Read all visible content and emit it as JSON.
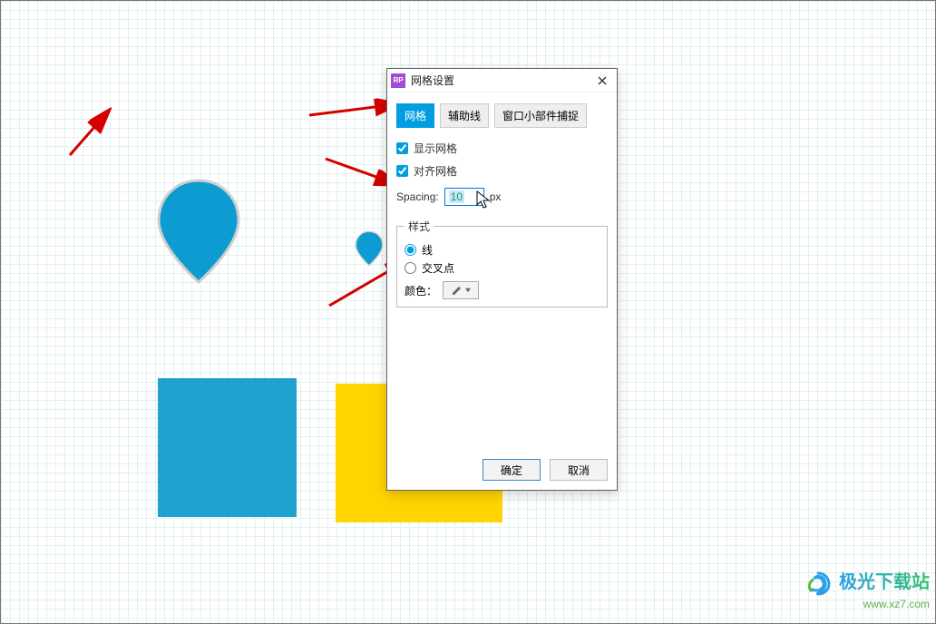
{
  "dialog": {
    "title": "网格设置",
    "app_icon_text": "RP",
    "tabs": {
      "grid": "网格",
      "guides": "辅助线",
      "snap": "窗口小部件捕捉"
    },
    "show_grid_label": "显示网格",
    "snap_grid_label": "对齐网格",
    "spacing_label": "Spacing:",
    "spacing_value": "10",
    "spacing_unit": "px",
    "style_legend": "样式",
    "style_line": "线",
    "style_cross": "交叉点",
    "color_label": "颜色：",
    "ok_label": "确定",
    "cancel_label": "取消"
  },
  "watermark": {
    "text": "极光下载站",
    "url": "www.xz7.com"
  }
}
